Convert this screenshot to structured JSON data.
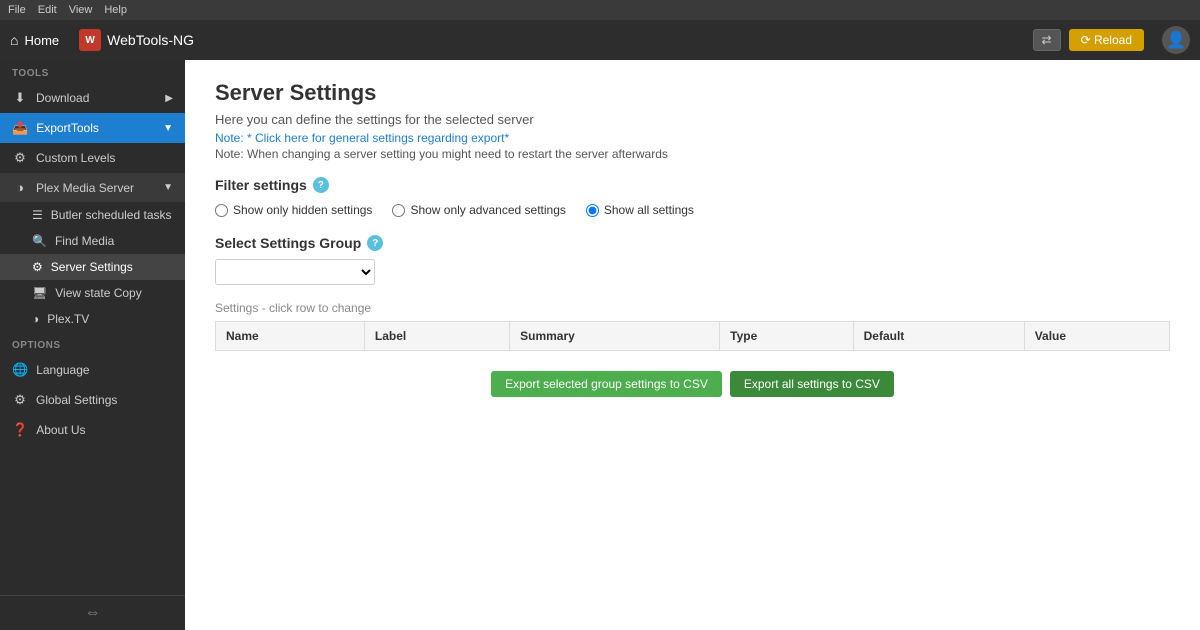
{
  "menubar": {
    "items": [
      "File",
      "Edit",
      "View",
      "Help"
    ]
  },
  "header": {
    "home_label": "Home",
    "app_logo_text": "W",
    "app_name": "WebTools-NG",
    "arrow_label": "⇄",
    "reload_label": "⟳ Reload"
  },
  "sidebar": {
    "tools_label": "TOOLS",
    "options_label": "OPTIONS",
    "items": [
      {
        "id": "download",
        "label": "Download",
        "icon": "⬇",
        "arrow": "▶"
      },
      {
        "id": "exporttools",
        "label": "ExportTools",
        "icon": "📤",
        "arrow": "▼",
        "active": true
      },
      {
        "id": "custom-levels",
        "label": "Custom Levels",
        "icon": "⚙"
      },
      {
        "id": "plex-media-server",
        "label": "Plex Media Server",
        "icon": "◑",
        "arrow": "▼",
        "expanded": true
      },
      {
        "id": "butler-scheduled-tasks",
        "label": "Butler scheduled tasks",
        "icon": "☰"
      },
      {
        "id": "find-media",
        "label": "Find Media",
        "icon": "🔍"
      },
      {
        "id": "server-settings",
        "label": "Server Settings",
        "icon": "⚙",
        "active_sub": true
      },
      {
        "id": "view-state-copy",
        "label": "View state Copy",
        "icon": "🖥"
      },
      {
        "id": "plex-tv",
        "label": "Plex.TV",
        "icon": "◑"
      }
    ],
    "option_items": [
      {
        "id": "language",
        "label": "Language",
        "icon": "🌐"
      },
      {
        "id": "global-settings",
        "label": "Global Settings",
        "icon": "⚙"
      },
      {
        "id": "about-us",
        "label": "About Us",
        "icon": "❓"
      }
    ],
    "footer_icon": "⇔"
  },
  "main": {
    "page_title": "Server Settings",
    "page_subtitle": "Here you can define the settings for the selected server",
    "note_link": "Note: * Click here for general settings regarding export*",
    "note_text": "Note: When changing a server setting you might need to restart the server afterwards",
    "filter_settings_label": "Filter settings",
    "radio_options": [
      {
        "id": "hidden",
        "label": "Show only hidden settings",
        "checked": false
      },
      {
        "id": "advanced",
        "label": "Show only advanced settings",
        "checked": false
      },
      {
        "id": "all",
        "label": "Show all settings",
        "checked": true
      }
    ],
    "select_group_label": "Select Settings Group",
    "table_hint": "Settings - click row to change",
    "table_columns": [
      "Name",
      "Label",
      "Summary",
      "Type",
      "Default",
      "Value"
    ],
    "export_btn_1": "Export selected group settings to CSV",
    "export_btn_2": "Export all settings to CSV"
  }
}
